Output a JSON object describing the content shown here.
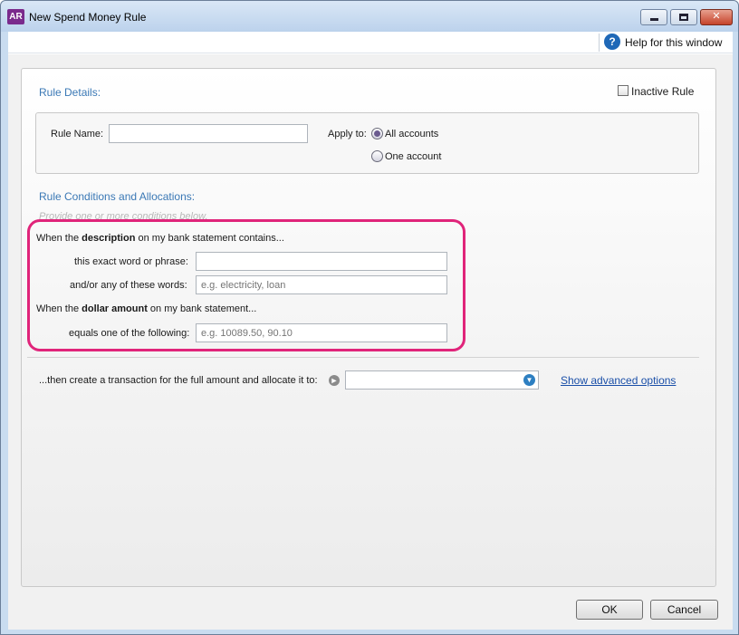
{
  "window": {
    "app_icon_text": "AR",
    "title": "New Spend Money Rule",
    "close_label": "✕"
  },
  "help": {
    "icon_text": "?",
    "label": "Help for this window"
  },
  "rule_details": {
    "heading": "Rule Details:",
    "inactive_label": "Inactive Rule",
    "inactive_checked": false,
    "rule_name_label": "Rule Name:",
    "rule_name_value": "",
    "apply_to_label": "Apply to:",
    "apply_options": [
      "All accounts",
      "One account"
    ],
    "apply_selected": "All accounts"
  },
  "conditions": {
    "heading": "Rule Conditions and Allocations:",
    "hint": "Provide one or more conditions below.",
    "description_prefix": "When the ",
    "description_bold": "description",
    "description_suffix": " on my bank statement contains...",
    "exact_label": "this exact word or phrase:",
    "exact_value": "",
    "any_words_label": "and/or any of these words:",
    "any_words_placeholder": "e.g. electricity, loan",
    "amount_prefix": "When the ",
    "amount_bold": "dollar amount",
    "amount_suffix": " on my bank statement...",
    "equals_label": "equals one of the following:",
    "equals_placeholder": "e.g. 10089.50, 90.10"
  },
  "allocation": {
    "label": "...then create a transaction for the full amount and allocate it to:",
    "account_value": "",
    "advanced_link": "Show advanced options"
  },
  "footer": {
    "ok_label": "OK",
    "cancel_label": "Cancel"
  },
  "colors": {
    "accent_heading": "#3a78b5",
    "highlight": "#e0247a",
    "link": "#1a4fa8"
  }
}
